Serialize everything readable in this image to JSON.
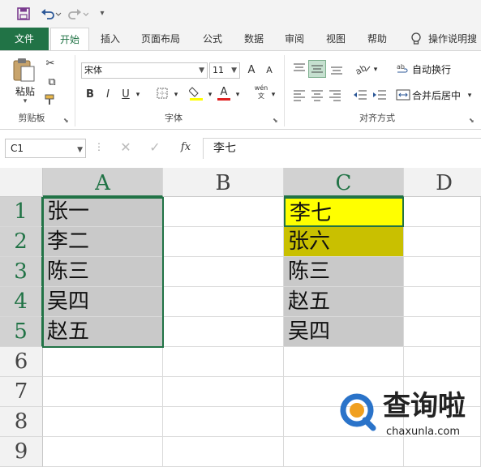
{
  "quick_access": {
    "icons": [
      "save-icon",
      "undo-icon",
      "redo-icon",
      "customize-icon"
    ]
  },
  "tabs": [
    "文件",
    "开始",
    "插入",
    "页面布局",
    "公式",
    "数据",
    "审阅",
    "视图",
    "帮助",
    "操作说明搜"
  ],
  "active_tab": "开始",
  "ribbon": {
    "clipboard": {
      "paste_label": "粘贴",
      "group_label": "剪贴板"
    },
    "font": {
      "font_name": "宋体",
      "font_size": "11",
      "bold": "B",
      "italic": "I",
      "underline": "U",
      "font_color_letter": "A",
      "phonetic": "wén",
      "grow": "A",
      "shrink": "A",
      "group_label": "字体"
    },
    "alignment": {
      "wrap_text": "自动换行",
      "merge_center": "合并后居中",
      "group_label": "对齐方式"
    }
  },
  "formula_bar": {
    "name_box": "C1",
    "fx": "fx",
    "formula": "李七"
  },
  "columns": [
    "A",
    "B",
    "C",
    "D"
  ],
  "rows": [
    "1",
    "2",
    "3",
    "4",
    "5",
    "6",
    "7",
    "8",
    "9"
  ],
  "column_a": [
    "张一",
    "李二",
    "陈三",
    "吴四",
    "赵五"
  ],
  "column_c": [
    "李七",
    "张六",
    "陈三",
    "赵五",
    "吴四"
  ],
  "colors": {
    "excel_green": "#217346",
    "highlight_yellow": "#ffff00",
    "highlight_olive": "#c9c000",
    "cell_gray": "#c9c9c9"
  },
  "watermark": {
    "brand": "查询啦",
    "domain": "chaxunla.com"
  }
}
